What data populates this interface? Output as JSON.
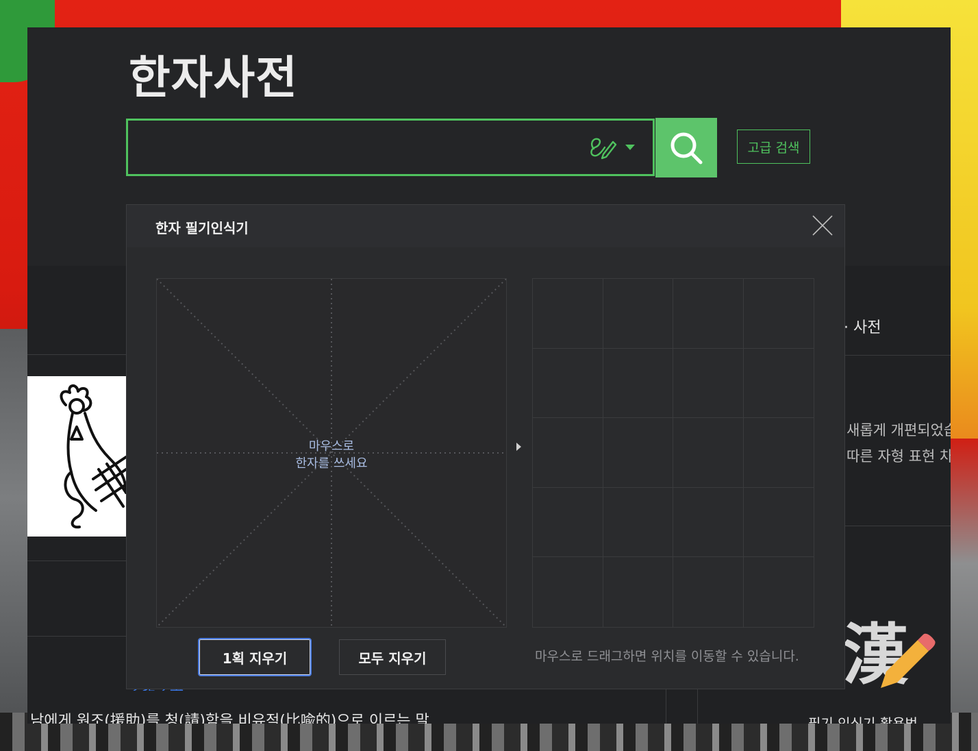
{
  "app": {
    "title": "한자사전"
  },
  "search": {
    "value": "",
    "placeholder": "",
    "handwrite_icon": "handwriting-pen-icon",
    "dropdown_icon": "caret-down-icon",
    "search_icon": "magnifier-icon",
    "advanced_label": "고급 검색"
  },
  "background": {
    "right_heading": "· 사전",
    "right_line1": "새롭게 개편되었습",
    "right_line2": "따른 자형 표현 차",
    "bottom_desc": "남에게 원조(援助)를 청(請)함을 비유적(比喩的)으로 이르는 말.",
    "bottom_link": "乞援之哭",
    "promo_glyph": "漢",
    "promo_bottom": "필기 인식기 활용법"
  },
  "recognizer": {
    "title": "한자 필기인식기",
    "close_icon": "close-icon",
    "draw_hint_line1": "마우스로",
    "draw_hint_line2": "한자를 쓰세요",
    "next_icon": "caret-right-icon",
    "candidates": [
      "",
      "",
      "",
      "",
      "",
      "",
      "",
      "",
      "",
      "",
      "",
      "",
      "",
      "",
      "",
      "",
      "",
      "",
      "",
      ""
    ],
    "erase_one_label": "1획 지우기",
    "erase_all_label": "모두 지우기",
    "drag_hint": "마우스로 드래그하면 위치를 이동할 수 있습니다."
  },
  "colors": {
    "accent_green": "#5dc46b",
    "focus_blue": "#4a7be0",
    "hint_blue": "#a9bde3"
  }
}
